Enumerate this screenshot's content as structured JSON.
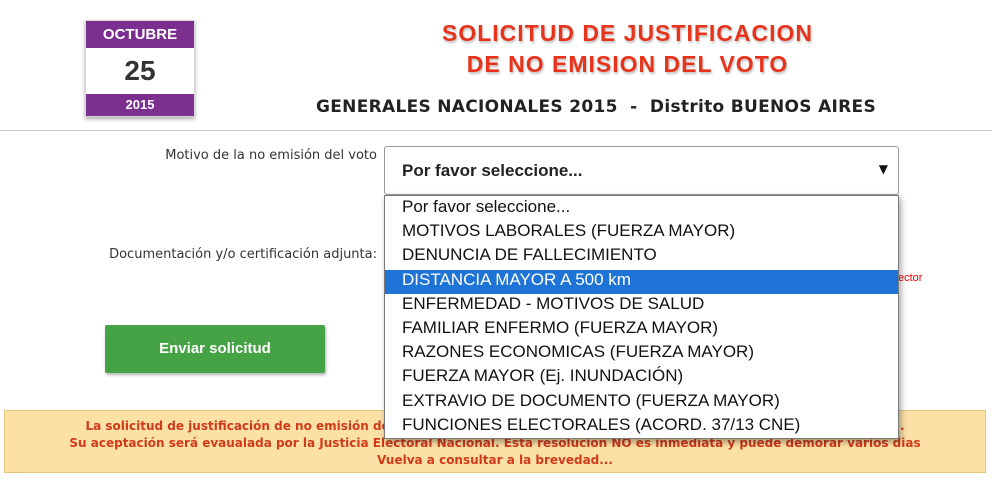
{
  "calendar": {
    "month": "OCTUBRE",
    "day": "25",
    "year": "2015"
  },
  "title": {
    "line1": "SOLICITUD DE JUSTIFICACION",
    "line2": "DE NO EMISION DEL VOTO"
  },
  "subtitle": "GENERALES NACIONALES 2015  -  Distrito BUENOS AIRES",
  "form": {
    "motivo_label": "Motivo de la no emisión del voto",
    "doc_label": "Documentación y/o certificación adjunta:",
    "select_value": "Por favor seleccione...",
    "select_arrow": "▼",
    "red_partial": "ector",
    "submit_label": "Enviar solicitud"
  },
  "dropdown": {
    "options": [
      "Por favor seleccione...",
      "MOTIVOS LABORALES (FUERZA MAYOR)",
      "DENUNCIA DE FALLECIMIENTO",
      "DISTANCIA MAYOR A 500 km",
      "ENFERMEDAD - MOTIVOS DE SALUD",
      "FAMILIAR ENFERMO (FUERZA MAYOR)",
      "RAZONES ECONOMICAS (FUERZA MAYOR)",
      "FUERZA MAYOR (Ej. INUNDACIÓN)",
      "EXTRAVIO DE DOCUMENTO (FUERZA MAYOR)",
      "FUNCIONES ELECTORALES (ACORD. 37/13 CNE)"
    ],
    "highlighted_option": "DISTANCIA MAYOR A 500 km"
  },
  "notice": {
    "line1": "La solicitud de justificación de no emisión del voto                                                                                                   Nacional.",
    "line2": "Su aceptación será evaualada por la Justicia Electoral Nacional. Esta resolución NO es inmediata y puede demorar varios dias",
    "line3": "Vuelva a consultar a la brevedad..."
  },
  "colors": {
    "calendar_purple": "#7b2f8e",
    "title_red": "#e8331c",
    "button_green": "#45a245",
    "notice_bg": "#fbe1a6",
    "highlight_blue": "#1e73d6"
  }
}
